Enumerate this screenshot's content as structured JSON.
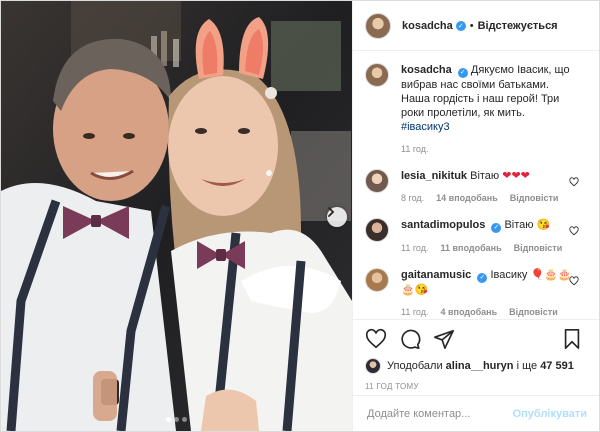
{
  "colors": {
    "accent": "#3897f0",
    "link": "#00376b",
    "muted": "#8e8e8e",
    "post_disabled": "#b2dffc",
    "heart_emoji": "#e0243c"
  },
  "header": {
    "username": "kosadcha",
    "separator": "•",
    "follow_status": "Відстежується"
  },
  "caption": {
    "username": "kosadcha",
    "text": "Дякуємо Івасик, що вибрав нас своїми батьками. Наша гордість і наш герой! Три роки пролетіли, як мить.",
    "hashtag": "#івасику3",
    "time": "11 год."
  },
  "comments": [
    {
      "username": "lesia_nikituk",
      "text": "Вітаю",
      "emoji": "❤❤❤",
      "time": "8 год.",
      "likes": "14 вподобань",
      "reply": "Відповісти"
    },
    {
      "username": "santadimopulos",
      "text": "Вітаю",
      "emoji": "😘",
      "time": "11 год.",
      "likes": "11 вподобань",
      "reply": "Відповісти"
    },
    {
      "username": "gaitanamusic",
      "text": "Івасику",
      "emoji": "🎈🎂🎂 🎂😘",
      "time": "11 год.",
      "likes": "4 вподобань",
      "reply": "Відповісти"
    }
  ],
  "likes": {
    "prefix": "Уподобали",
    "user": "alina__huryn",
    "and": "і ще",
    "count": "47 591"
  },
  "timestamp": "11 ГОД ТОМУ",
  "add_comment": {
    "placeholder": "Додайте коментар...",
    "post_label": "Опублікувати"
  },
  "icons": {
    "like": "heart-icon",
    "comment": "comment-icon",
    "share": "share-icon",
    "save": "bookmark-icon",
    "next": "chevron-right-icon"
  }
}
